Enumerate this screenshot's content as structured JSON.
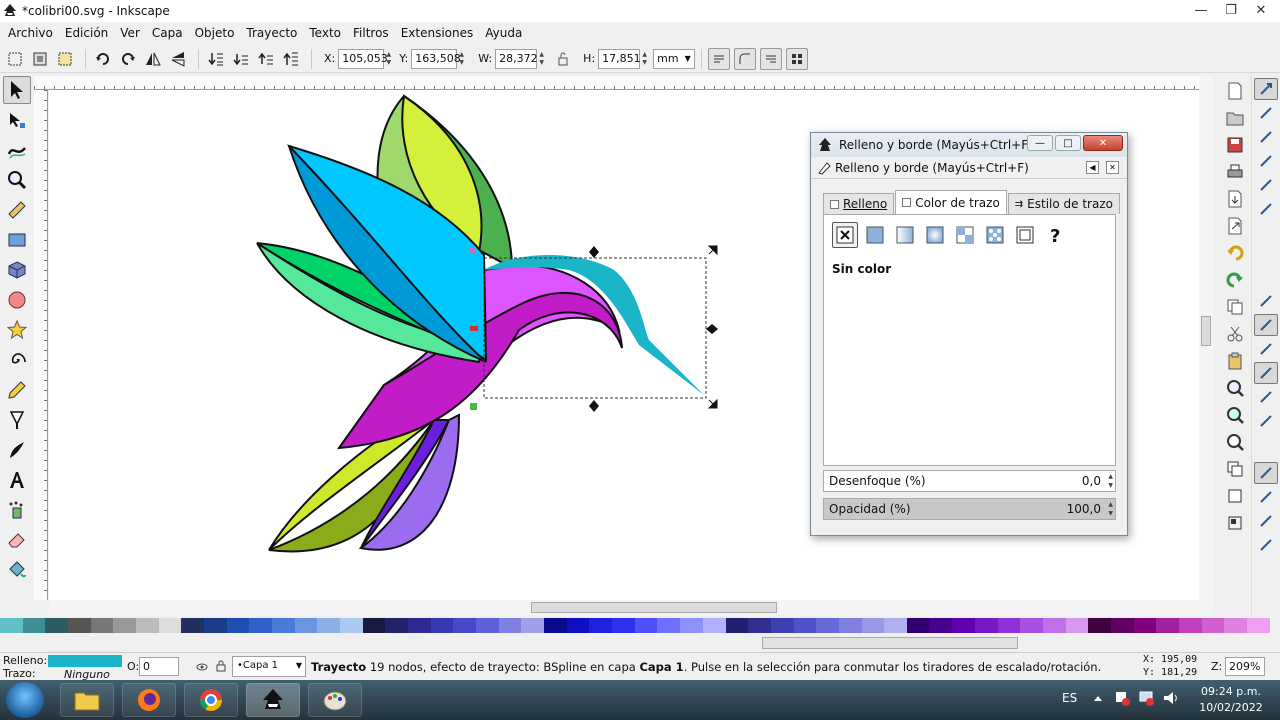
{
  "window": {
    "title": "*colibri00.svg - Inkscape",
    "controls": [
      "—",
      "❐",
      "✕"
    ]
  },
  "menu": [
    "Archivo",
    "Edición",
    "Ver",
    "Capa",
    "Objeto",
    "Trayecto",
    "Texto",
    "Filtros",
    "Extensiones",
    "Ayuda"
  ],
  "tool_controls": {
    "x_label": "X:",
    "x_value": "105,053",
    "y_label": "Y:",
    "y_value": "163,508",
    "w_label": "W:",
    "w_value": "28,372",
    "h_label": "H:",
    "h_value": "17,851",
    "unit": "mm"
  },
  "dialog": {
    "window_title": "Relleno y borde (Mayús+Ctrl+F)",
    "panel_title": "Relleno y borde (Mayús+Ctrl+F)",
    "tabs": [
      "Relleno",
      "Color de trazo",
      "Estilo de trazo"
    ],
    "paint_status": "Sin color",
    "blur_label": "Desenfoque (%)",
    "blur_value": "0,0",
    "opacity_label": "Opacidad (%)",
    "opacity_value": "100,0"
  },
  "status": {
    "fill_label": "Relleno:",
    "stroke_label": "Trazo:",
    "stroke_value": "Ninguno",
    "fill_color": "#1ab5c8",
    "opacity_label": "O:",
    "opacity_value": "0",
    "layer": "•Capa 1",
    "msg_bold1": "Trayecto",
    "msg_text1": " 19 nodos, efecto de trayecto: BSpline en capa ",
    "msg_bold2": "Capa 1",
    "msg_text2": ". Pulse en la selección para conmutar los tiradores de escalado/rotación.",
    "x_coord": "X:  195,09",
    "y_coord": "Y:  181,29",
    "zoom_label": "Z:",
    "zoom": "209%"
  },
  "taskbar": {
    "lang": "ES",
    "time": "09:24 p.m.",
    "date": "10/02/2022"
  },
  "colors": {
    "accent": "#1ab5c8"
  }
}
